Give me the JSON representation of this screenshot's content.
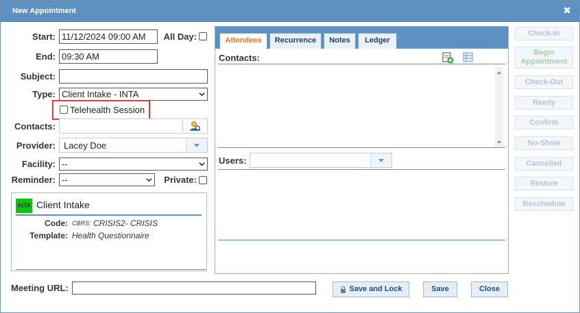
{
  "window": {
    "title": "New Appointment",
    "close_symbol": "✖"
  },
  "form": {
    "start_label": "Start:",
    "start_value": "11/12/2024 09:00 AM",
    "allday_label": "All Day:",
    "end_label": "End:",
    "end_value": "09:30 AM",
    "subject_label": "Subject:",
    "subject_value": "",
    "type_label": "Type:",
    "type_value": "Client Intake - INTA",
    "telehealth_label": "Telehealth Session",
    "contacts_label": "Contacts:",
    "contacts_value": "",
    "provider_label": "Provider:",
    "provider_value": "Lacey Doe",
    "facility_label": "Facility:",
    "facility_value": "--",
    "reminder_label": "Reminder:",
    "reminder_value": "--",
    "private_label": "Private:"
  },
  "appointment_type": {
    "badge": "INTA",
    "badge_color": "#11c411",
    "name": "Client Intake",
    "code_label": "Code:",
    "code_prefix": "CBRS:",
    "code_value": "CRISIS2- CRISIS",
    "template_label": "Template:",
    "template_value": "Health Questionnaire"
  },
  "tabs": [
    {
      "label": "Attendees",
      "active": true
    },
    {
      "label": "Recurrence",
      "active": false
    },
    {
      "label": "Notes",
      "active": false
    },
    {
      "label": "Ledger",
      "active": false
    }
  ],
  "attendees": {
    "contacts_label": "Contacts:",
    "users_label": "Users:",
    "users_value": ""
  },
  "status_buttons": {
    "check_in": "Check-In",
    "begin": "Begin Appointment",
    "check_out": "Check-Out",
    "ready": "Ready",
    "confirm": "Confirm",
    "no_show": "No-Show",
    "cancelled": "Cancelled",
    "restore": "Restore",
    "reschedule": "Reschedule"
  },
  "footer": {
    "meeting_url_label": "Meeting URL:",
    "meeting_url_value": "",
    "save_lock": "Save and Lock",
    "save": "Save",
    "close": "Close"
  },
  "colors": {
    "titlebar": "#5d91c2",
    "active_tab_text": "#e07a1f",
    "highlight": "#e0393c"
  }
}
